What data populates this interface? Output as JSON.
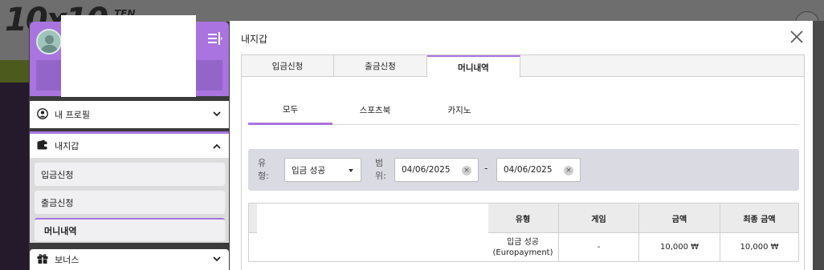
{
  "background": {
    "logo_text": "10x10",
    "logo_sub": "TEN"
  },
  "sidebar": {
    "profile": {
      "name_hidden": ""
    },
    "items": [
      {
        "label": "내 프로필"
      },
      {
        "label": "내지갑"
      },
      {
        "label": "보너스"
      }
    ],
    "wallet_submenu": [
      {
        "label": "입금신청"
      },
      {
        "label": "출금신청"
      },
      {
        "label": "머니내역"
      }
    ]
  },
  "modal": {
    "title": "내지갑",
    "tabs": [
      {
        "label": "입금신청"
      },
      {
        "label": "출금신청"
      },
      {
        "label": "머니내역"
      }
    ],
    "subtabs": [
      {
        "label": "모두"
      },
      {
        "label": "스포츠북"
      },
      {
        "label": "카지노"
      }
    ],
    "filter": {
      "type_label": "유형:",
      "type_value": "입금 성공",
      "range_label": "범위:",
      "date_from": "04/06/2025",
      "date_to": "04/06/2025",
      "separator": "-"
    },
    "table": {
      "headers": [
        "유형",
        "게임",
        "금액",
        "최종 금액"
      ],
      "rows": [
        {
          "type_line1": "입금 성공",
          "type_line2": "(Europayment)",
          "game": "-",
          "amount": "10,000 ₩",
          "final": "10,000 ₩"
        }
      ]
    }
  },
  "colors": {
    "accent": "#a974e0",
    "filter_bg": "#dadae3"
  }
}
